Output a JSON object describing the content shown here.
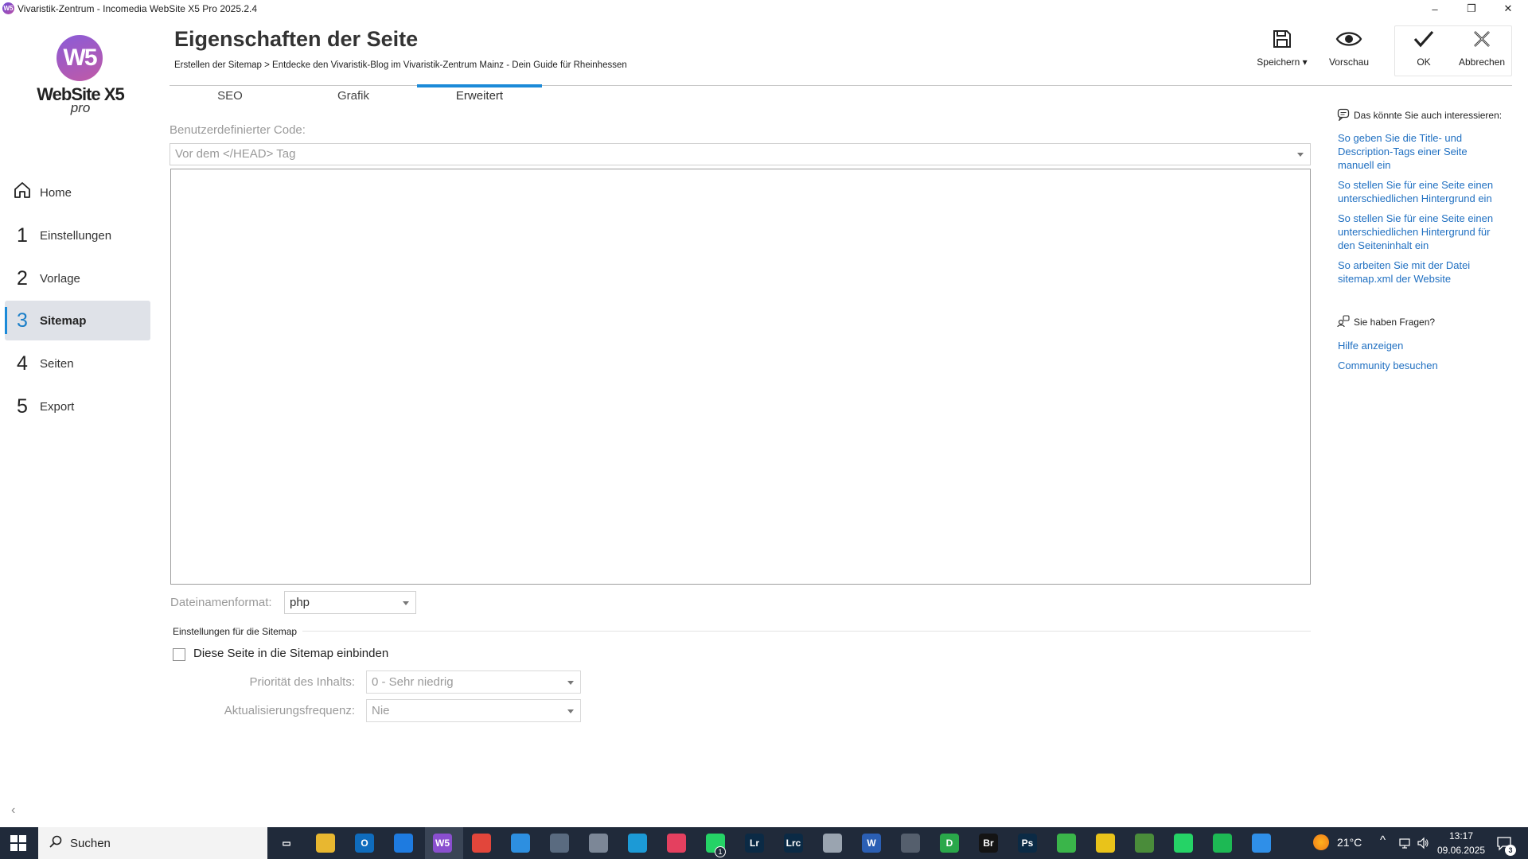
{
  "window": {
    "title": "Vivaristik-Zentrum - Incomedia WebSite X5 Pro 2025.2.4",
    "app_icon": "W5",
    "minimize": "–",
    "restore": "❐",
    "close": "✕"
  },
  "logo": {
    "mark": "W5",
    "name": "WebSite X5",
    "edition": "pro"
  },
  "sidebar": {
    "items": [
      {
        "num": "⌂",
        "label": "Home"
      },
      {
        "num": "1",
        "label": "Einstellungen"
      },
      {
        "num": "2",
        "label": "Vorlage"
      },
      {
        "num": "3",
        "label": "Sitemap",
        "active": true
      },
      {
        "num": "4",
        "label": "Seiten"
      },
      {
        "num": "5",
        "label": "Export"
      }
    ],
    "collapse": "‹"
  },
  "header": {
    "title": "Eigenschaften der Seite",
    "breadcrumb": "Erstellen der Sitemap > Entdecke den Vivaristik-Blog im Vivaristik-Zentrum Mainz - Dein Guide für Rheinhessen",
    "buttons": {
      "save": "Speichern ▾",
      "preview": "Vorschau",
      "ok": "OK",
      "cancel": "Abbrechen"
    }
  },
  "tabs": [
    {
      "label": "SEO"
    },
    {
      "label": "Grafik"
    },
    {
      "label": "Erweitert",
      "active": true
    }
  ],
  "form": {
    "custom_code_label": "Benutzerdefinierter Code:",
    "code_position": "Vor dem </HEAD> Tag",
    "code_content": "",
    "filename_label": "Dateinamenformat:",
    "filename_value": "php",
    "sitemap_section": "Einstellungen für die Sitemap",
    "include_checkbox": "Diese Seite in die Sitemap einbinden",
    "include_checked": false,
    "priority_label": "Priorität des Inhalts:",
    "priority_value": "0 - Sehr niedrig",
    "frequency_label": "Aktualisierungsfrequenz:",
    "frequency_value": "Nie"
  },
  "right_panel": {
    "interest_title": "Das könnte Sie auch interessieren:",
    "links": [
      "So geben Sie die Title- und Description-Tags einer Seite manuell ein",
      "So stellen Sie für eine Seite einen unterschiedlichen Hintergrund ein",
      "So stellen Sie für eine Seite einen unterschiedlichen Hintergrund für den Seiteninhalt ein",
      "So arbeiten Sie mit der Datei sitemap.xml der Website"
    ],
    "questions_title": "Sie haben Fragen?",
    "help_link": "Hilfe anzeigen",
    "community_link": "Community besuchen"
  },
  "taskbar": {
    "search_placeholder": "Suchen",
    "apps": [
      {
        "name": "task-view-icon",
        "label": "▭",
        "color": "#202a3a"
      },
      {
        "name": "file-explorer-icon",
        "label": "",
        "color": "#e8b730"
      },
      {
        "name": "outlook-icon",
        "label": "O",
        "color": "#0f6cbd"
      },
      {
        "name": "browser-blue-icon",
        "label": "",
        "color": "#1e7be0"
      },
      {
        "name": "website-x5-icon",
        "label": "W5",
        "color": "#8a4fcf"
      },
      {
        "name": "chrome-icon",
        "label": "",
        "color": "#e2463b"
      },
      {
        "name": "mail-app-icon",
        "label": "",
        "color": "#2d8fe0"
      },
      {
        "name": "calculator-icon",
        "label": "",
        "color": "#5a6b80"
      },
      {
        "name": "news-icon",
        "label": "",
        "color": "#7c8797"
      },
      {
        "name": "edge-icon",
        "label": "",
        "color": "#1c9ad6"
      },
      {
        "name": "creative-cloud-icon",
        "label": "",
        "color": "#e4405f"
      },
      {
        "name": "whatsapp-badge-icon",
        "label": "",
        "color": "#25d366"
      },
      {
        "name": "lightroom-icon",
        "label": "Lr",
        "color": "#0b2a45"
      },
      {
        "name": "lightroom-classic-icon",
        "label": "Lrc",
        "color": "#0b2a45"
      },
      {
        "name": "cloud-app-icon",
        "label": "",
        "color": "#9aa4b0"
      },
      {
        "name": "word-icon",
        "label": "W",
        "color": "#2b5fb4"
      },
      {
        "name": "game-icon",
        "label": "",
        "color": "#555f6d"
      },
      {
        "name": "d-app-icon",
        "label": "D",
        "color": "#2aa84a"
      },
      {
        "name": "bridge-icon",
        "label": "Br",
        "color": "#141414"
      },
      {
        "name": "photoshop-icon",
        "label": "Ps",
        "color": "#0b2a45"
      },
      {
        "name": "notes-green-icon",
        "label": "",
        "color": "#3ab54a"
      },
      {
        "name": "calendar-2025-icon",
        "label": "",
        "color": "#e9c31a"
      },
      {
        "name": "xbox-like-icon",
        "label": "",
        "color": "#4a8c3a"
      },
      {
        "name": "whatsapp-icon",
        "label": "",
        "color": "#25d366"
      },
      {
        "name": "spotify-icon",
        "label": "",
        "color": "#1db954"
      },
      {
        "name": "photo-app-icon",
        "label": "",
        "color": "#2f8fe8"
      }
    ],
    "weather": "21°C",
    "time": "13:17",
    "date": "09.06.2025",
    "notifications": "3",
    "whatsapp_badge": "1"
  }
}
